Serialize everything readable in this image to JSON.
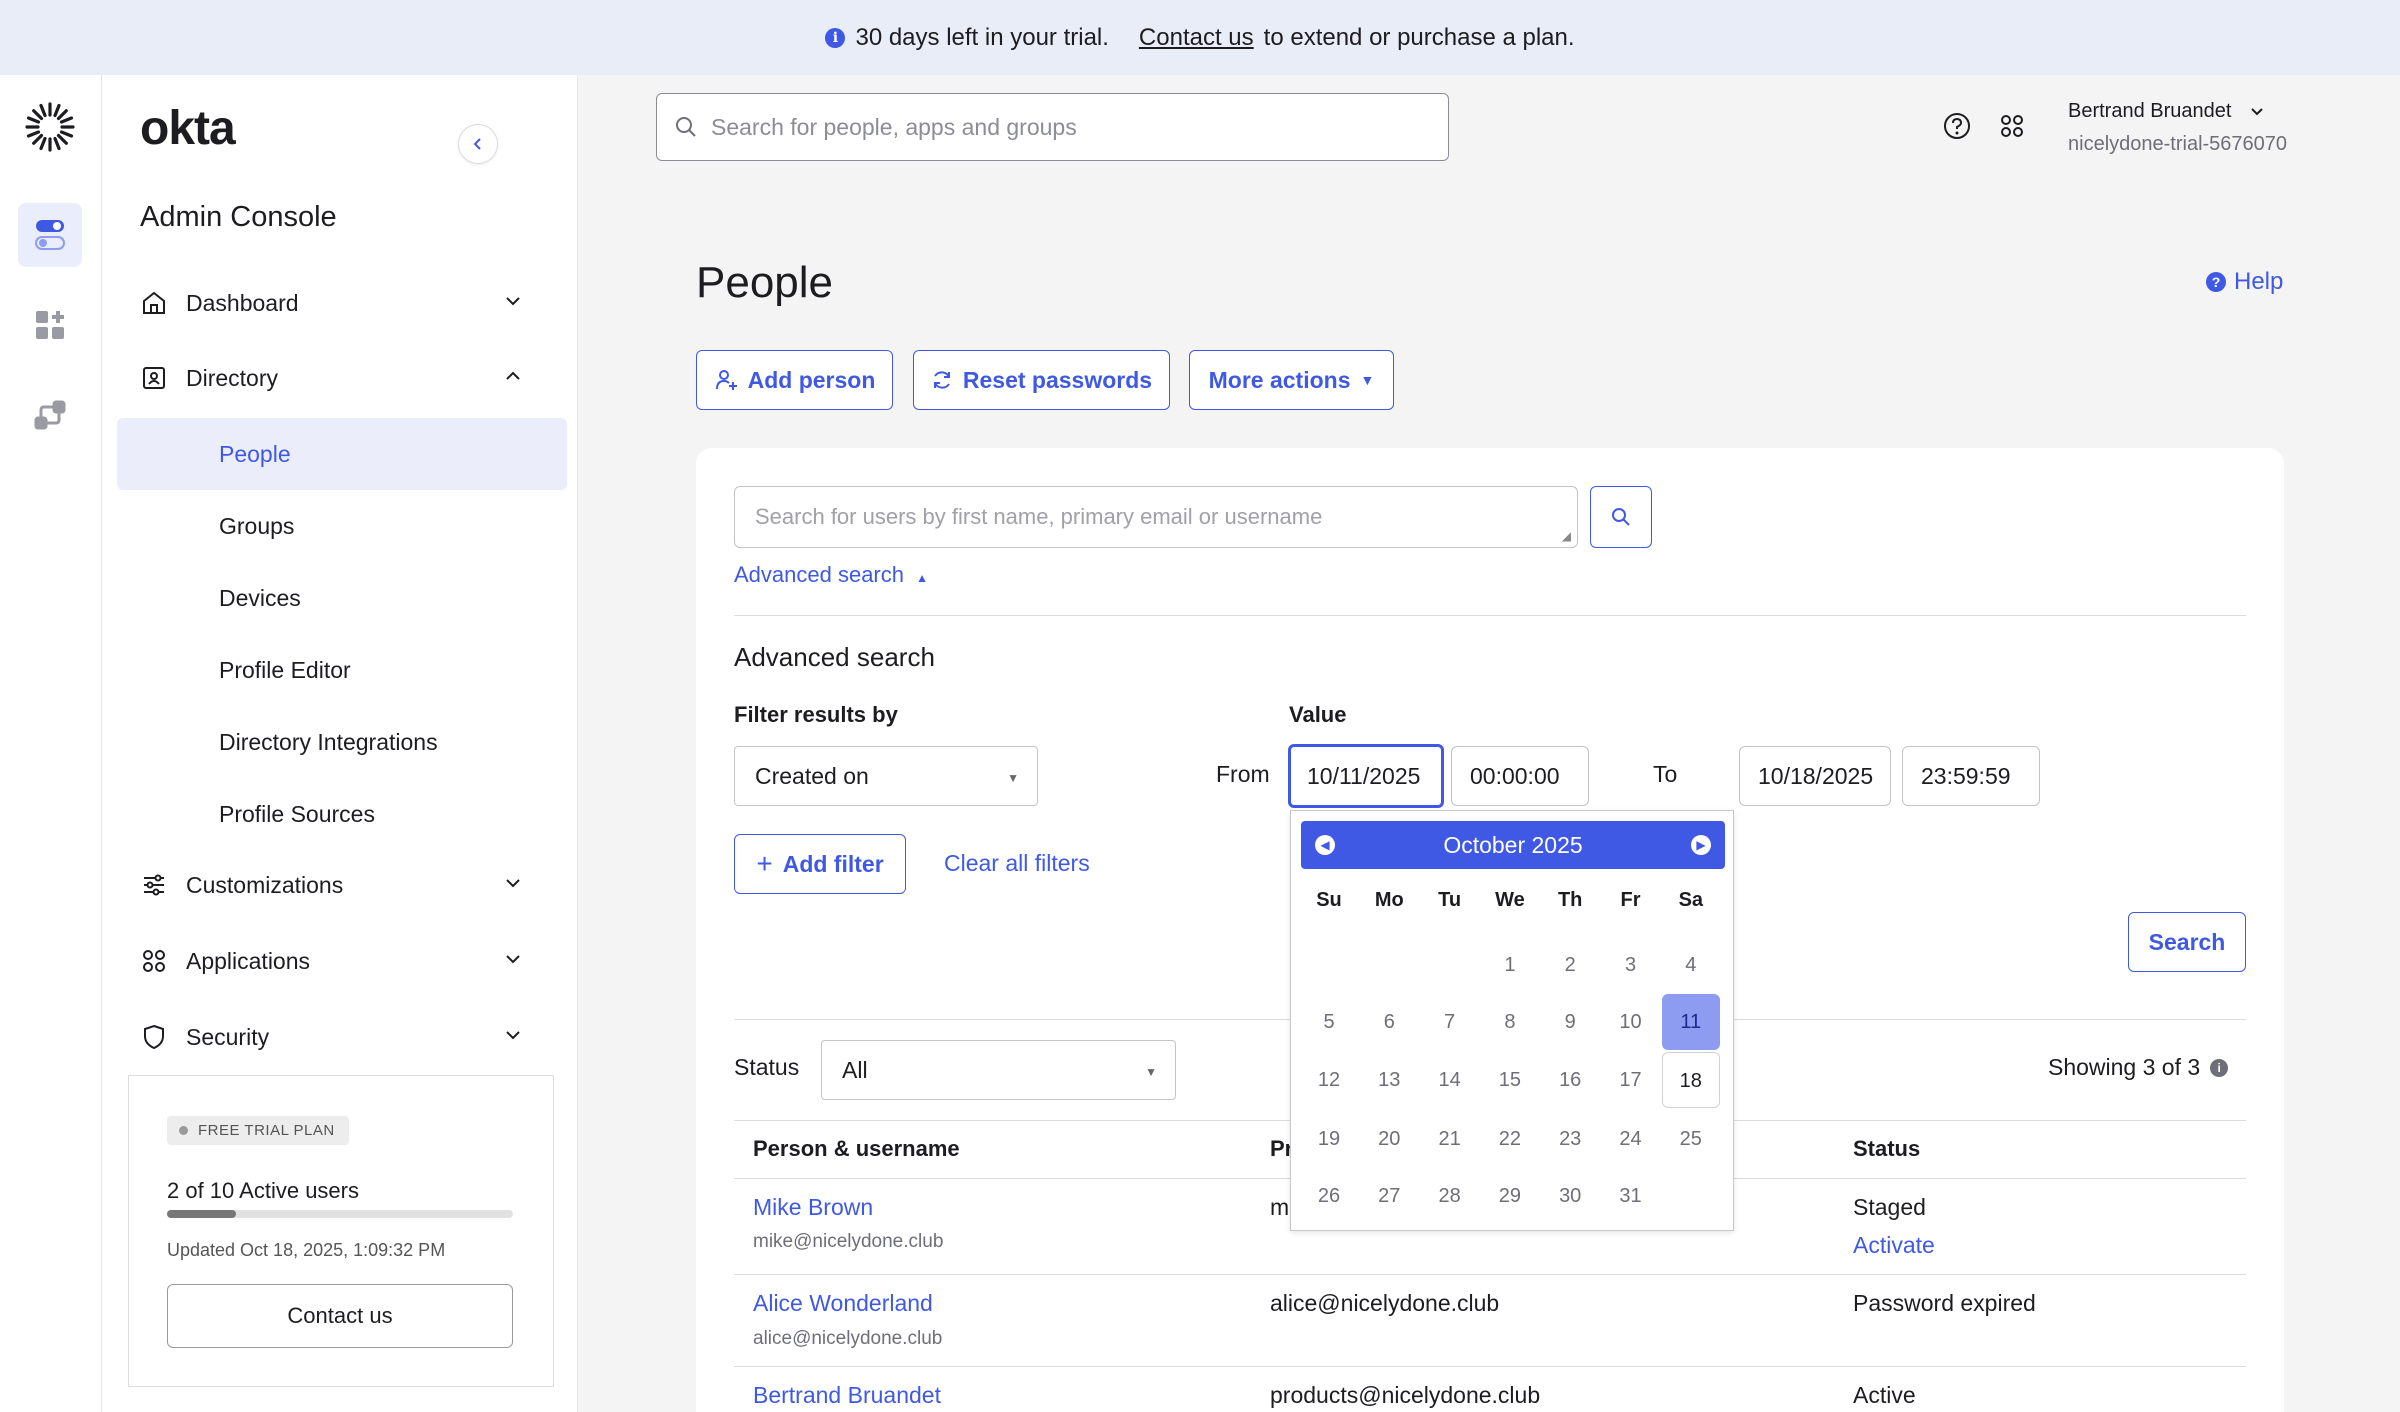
{
  "banner": {
    "text": "30 days left in your trial.",
    "link": "Contact us",
    "suffix": "to extend or purchase a plan."
  },
  "sidebar": {
    "brand": "okta",
    "title": "Admin Console",
    "nav": {
      "dashboard": "Dashboard",
      "directory": "Directory",
      "customizations": "Customizations",
      "applications": "Applications",
      "security": "Security"
    },
    "directory_items": [
      "People",
      "Groups",
      "Devices",
      "Profile Editor",
      "Directory Integrations",
      "Profile Sources"
    ],
    "trial": {
      "badge": "FREE TRIAL PLAN",
      "users": "2 of 10 Active users",
      "progress": 0.2,
      "updated": "Updated Oct 18, 2025, 1:09:32 PM",
      "contact": "Contact us"
    }
  },
  "header": {
    "search_placeholder": "Search for people, apps and groups",
    "user_name": "Bertrand Bruandet",
    "org": "nicelydone-trial-5676070"
  },
  "page": {
    "title": "People",
    "help": "Help",
    "actions": {
      "add_person": "Add person",
      "reset_passwords": "Reset passwords",
      "more_actions": "More actions"
    }
  },
  "search": {
    "placeholder": "Search for users by first name, primary email or username",
    "advanced_link": "Advanced search",
    "advanced_title": "Advanced search",
    "filter_label": "Filter results by",
    "filter_value": "Created on",
    "value_label": "Value",
    "from_label": "From",
    "from_date": "10/11/2025",
    "from_time": "00:00:00",
    "to_label": "To",
    "to_date": "10/18/2025",
    "to_time": "23:59:59",
    "add_filter": "Add filter",
    "clear_filters": "Clear all filters",
    "search_button": "Search"
  },
  "table": {
    "status_label": "Status",
    "status_value": "All",
    "showing": "Showing 3 of 3",
    "headers": [
      "Person & username",
      "Pr",
      "Status"
    ],
    "rows": [
      {
        "name": "Mike Brown",
        "username": "mike@nicelydone.club",
        "email": "m",
        "status": "Staged",
        "action": "Activate"
      },
      {
        "name": "Alice Wonderland",
        "username": "alice@nicelydone.club",
        "email": "alice@nicelydone.club",
        "status": "Password expired",
        "action": ""
      },
      {
        "name": "Bertrand Bruandet",
        "username": "",
        "email": "products@nicelydone.club",
        "status": "Active",
        "action": ""
      }
    ]
  },
  "calendar": {
    "month": "October 2025",
    "dow": [
      "Su",
      "Mo",
      "Tu",
      "We",
      "Th",
      "Fr",
      "Sa"
    ],
    "weeks": [
      [
        "",
        "",
        "",
        "1",
        "2",
        "3",
        "4"
      ],
      [
        "5",
        "6",
        "7",
        "8",
        "9",
        "10",
        "11"
      ],
      [
        "12",
        "13",
        "14",
        "15",
        "16",
        "17",
        "18"
      ],
      [
        "19",
        "20",
        "21",
        "22",
        "23",
        "24",
        "25"
      ],
      [
        "26",
        "27",
        "28",
        "29",
        "30",
        "31",
        ""
      ]
    ],
    "selected": "11",
    "today": "18"
  },
  "colors": {
    "accent": "#3f59e4",
    "banner_bg": "#e9edf7",
    "selected_day": "#8d9cf0"
  }
}
